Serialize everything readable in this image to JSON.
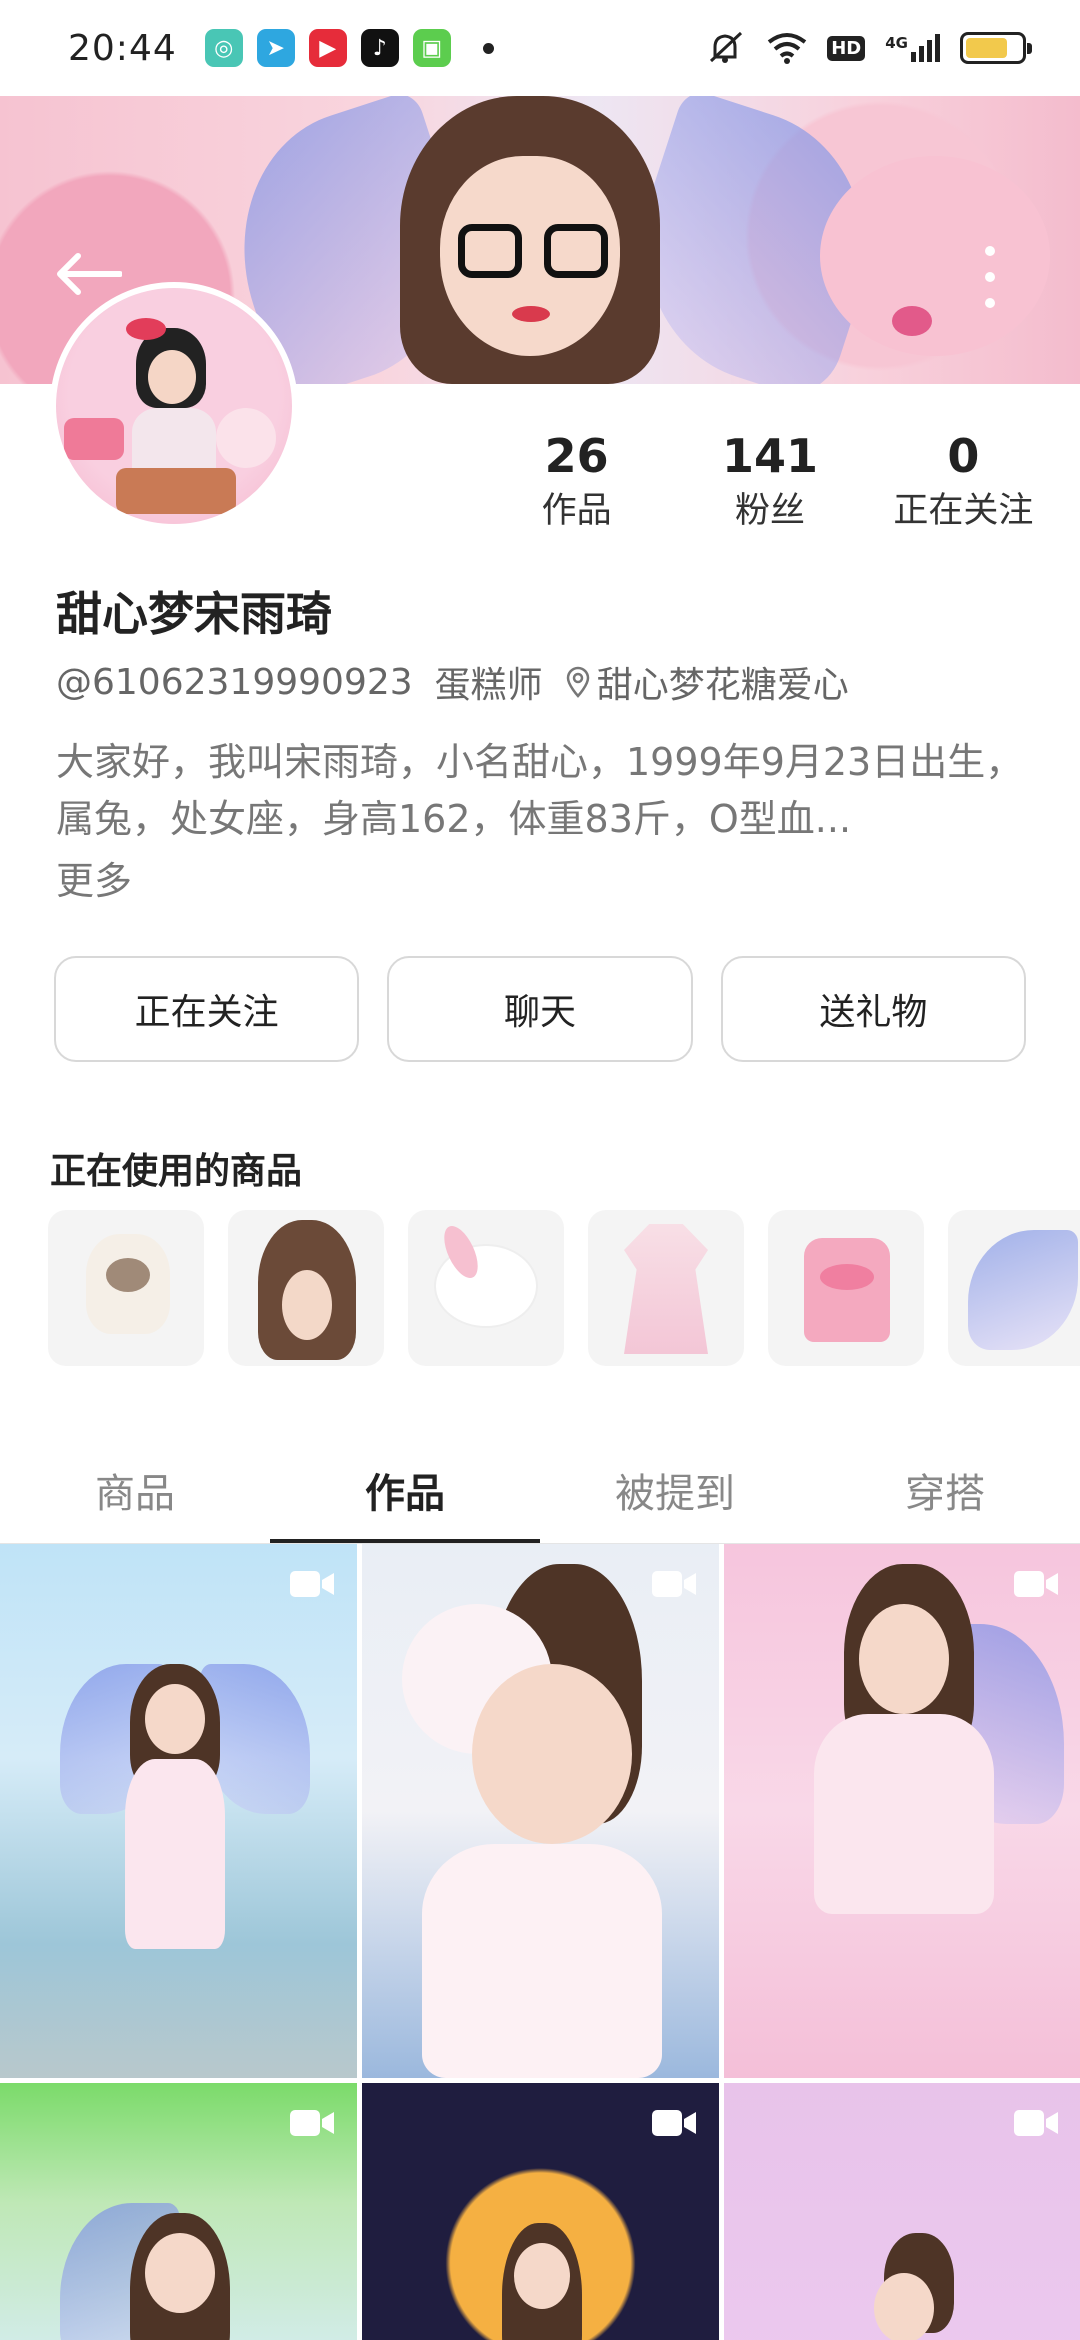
{
  "status_bar": {
    "time": "20:44",
    "app_icons": [
      {
        "name": "app-icon-green",
        "color": "#49c6b5",
        "glyph": "◎"
      },
      {
        "name": "telegram-icon",
        "color": "#2ea7e0",
        "glyph": "➤"
      },
      {
        "name": "youtube-icon",
        "color": "#e62c3a",
        "glyph": "▶"
      },
      {
        "name": "tiktok-icon",
        "color": "#111111",
        "glyph": "♪"
      },
      {
        "name": "app-icon-lime",
        "color": "#5ccd4e",
        "glyph": "▣"
      }
    ],
    "network": "4G",
    "hd_label": "HD"
  },
  "profile": {
    "name": "甜心梦宋雨琦",
    "handle": "@61062319990923",
    "occupation": "蛋糕师",
    "location": "甜心梦花糖爱心",
    "bio": "大家好，我叫宋雨琦，小名甜心，1999年9月23日出生，属兔，处女座，身高162，体重83斤，O型血...",
    "more_label": "更多"
  },
  "stats": [
    {
      "value": "26",
      "label": "作品"
    },
    {
      "value": "141",
      "label": "粉丝"
    },
    {
      "value": "0",
      "label": "正在关注"
    }
  ],
  "actions": {
    "follow_label": "正在关注",
    "chat_label": "聊天",
    "gift_label": "送礼物"
  },
  "items_section": {
    "title": "正在使用的商品",
    "items": [
      "cat-plush",
      "hairstyle",
      "bunny-plush",
      "pink-dress",
      "pink-backpack",
      "fairy-wings"
    ]
  },
  "tabs": [
    "商品",
    "作品",
    "被提到",
    "穿搭"
  ],
  "active_tab": "作品",
  "colors": {
    "accent": "#222222",
    "muted_text": "#777777",
    "border": "#d8d8d8"
  }
}
